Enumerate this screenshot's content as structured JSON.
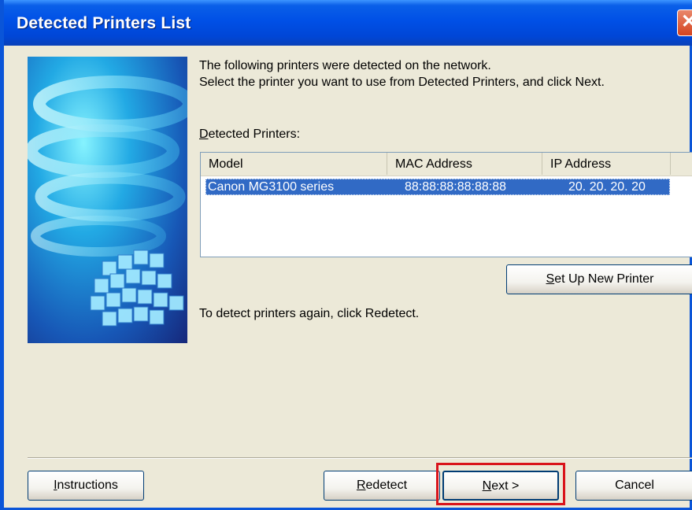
{
  "window": {
    "title": "Detected Printers List",
    "close_symbol": "✕"
  },
  "intro": {
    "line1": "The following printers were detected on the network.",
    "line2": "Select the printer you want to use from Detected Printers, and click Next."
  },
  "detected_label": {
    "mnemonic": "D",
    "rest": "etected Printers:"
  },
  "printer_list": {
    "columns": [
      "Model",
      "MAC Address",
      "IP Address"
    ],
    "rows": [
      {
        "model": "Canon MG3100 series",
        "mac": "88:88:88:88:88:88",
        "ip": "20. 20. 20. 20",
        "selected": true
      }
    ]
  },
  "setup_button": {
    "mnemonic": "S",
    "rest": "et Up New Printer"
  },
  "redetect_hint": "To detect printers again, click Redetect.",
  "footer": {
    "instructions": {
      "mnemonic": "I",
      "rest": "nstructions"
    },
    "redetect": {
      "mnemonic": "R",
      "rest": "edetect"
    },
    "next": {
      "mnemonic": "N",
      "rest": "ext >"
    },
    "cancel": "Cancel"
  },
  "colors": {
    "titlebar": "#0050E6",
    "selection": "#316AC5",
    "highlight": "#D9141B",
    "dialog_bg": "#ECE9D8"
  },
  "icons": [
    "close-icon"
  ]
}
